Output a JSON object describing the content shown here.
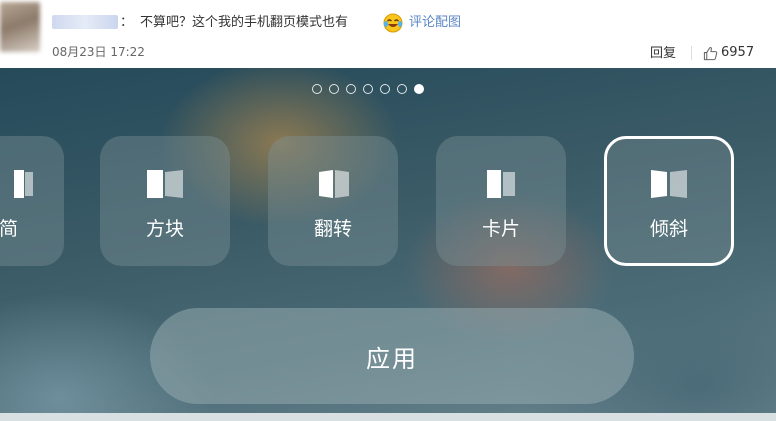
{
  "comment": {
    "colon": "：",
    "text": "不算吧？这个我的手机翻页模式也有",
    "emoji": "laughing-tears-emoji",
    "link": "评论配图",
    "timestamp": "08月23日 17:22",
    "reply_label": "回复",
    "like_count": "6957",
    "like_icon": "thumbs-up-icon",
    "link_color": "#5b86c6"
  },
  "screenshot": {
    "page_indicator": {
      "total": 7,
      "active_index": 6
    },
    "tiles": [
      {
        "label": "简",
        "icon": "page-flip-icon"
      },
      {
        "label": "方块",
        "icon": "page-flip-icon"
      },
      {
        "label": "翻转",
        "icon": "page-flip-icon"
      },
      {
        "label": "卡片",
        "icon": "page-flip-icon"
      },
      {
        "label": "倾斜",
        "icon": "page-flip-icon",
        "selected": true
      }
    ],
    "apply_label": "应用"
  }
}
